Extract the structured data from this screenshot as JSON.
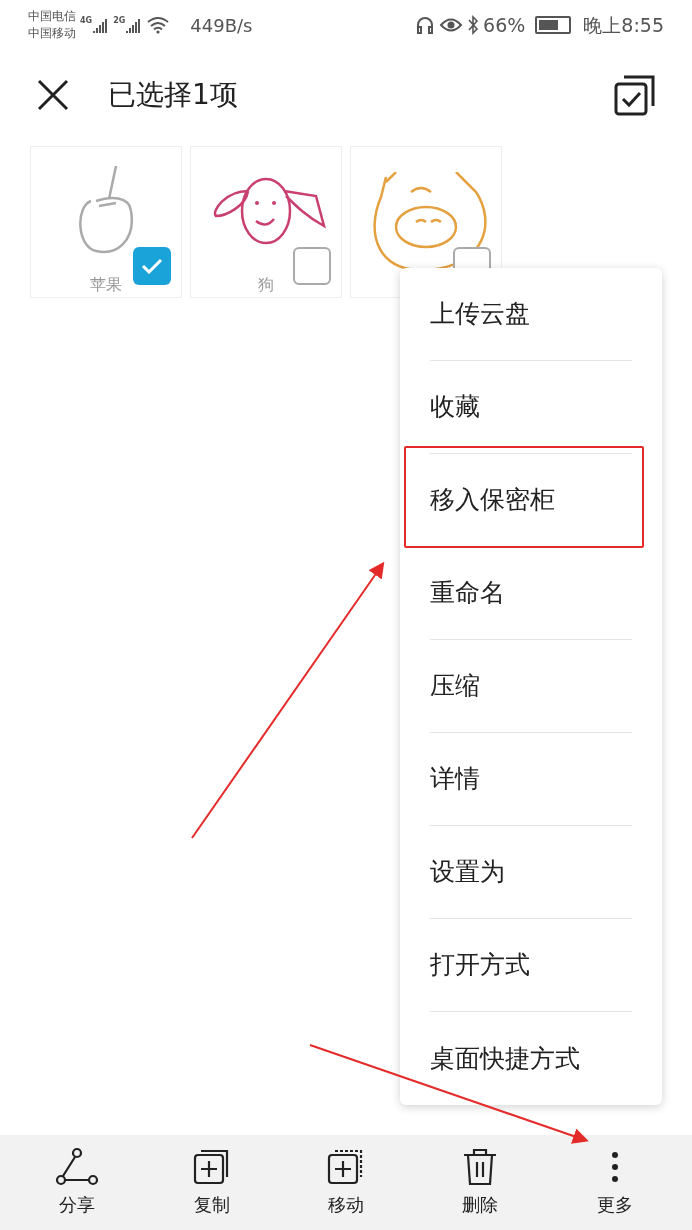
{
  "status_bar": {
    "carrier_1": "中国电信",
    "carrier_2": "中国移动",
    "network_1": "4G",
    "network_2": "2G",
    "speed": "449B/s",
    "battery": "66%",
    "time": "晚上8:55"
  },
  "header": {
    "title": "已选择1项"
  },
  "files": [
    {
      "name": "苹果",
      "kind": "apple",
      "selected": true
    },
    {
      "name": "狗",
      "kind": "dog",
      "selected": false
    },
    {
      "kind": "pig",
      "selected": false
    }
  ],
  "menu": [
    {
      "label": "上传云盘",
      "highlighted": false
    },
    {
      "label": "收藏",
      "highlighted": false
    },
    {
      "label": "移入保密柜",
      "highlighted": true
    },
    {
      "label": "重命名",
      "highlighted": false
    },
    {
      "label": "压缩",
      "highlighted": false
    },
    {
      "label": "详情",
      "highlighted": false
    },
    {
      "label": "设置为",
      "highlighted": false
    },
    {
      "label": "打开方式",
      "highlighted": false
    },
    {
      "label": "桌面快捷方式",
      "highlighted": false
    }
  ],
  "toolbar": [
    {
      "label": "分享",
      "kind": "share"
    },
    {
      "label": "复制",
      "kind": "copy"
    },
    {
      "label": "移动",
      "kind": "move"
    },
    {
      "label": "删除",
      "kind": "delete"
    },
    {
      "label": "更多",
      "kind": "more"
    }
  ]
}
